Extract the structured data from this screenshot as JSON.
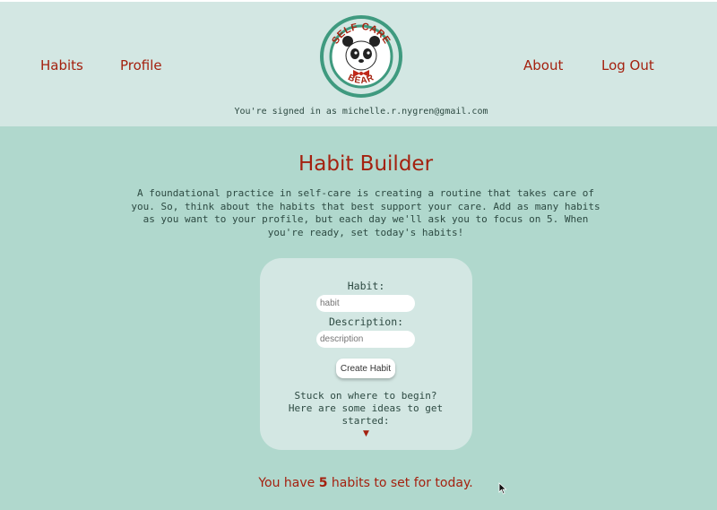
{
  "nav": {
    "habits": "Habits",
    "profile": "Profile",
    "about": "About",
    "logout": "Log Out"
  },
  "logo": {
    "top_text": "SELF CARE",
    "bottom_text": "BEAR"
  },
  "signed_in": "You're signed in as michelle.r.nygren@gmail.com",
  "main": {
    "title": "Habit Builder",
    "intro": "A foundational practice in self-care is creating a routine that takes care of you. So, think about the habits that best support your care. Add as many habits as you want to your profile, but each day we'll ask you to focus on 5. When you're ready, set today's habits!"
  },
  "form": {
    "habit_label": "Habit:",
    "habit_placeholder": "habit",
    "description_label": "Description:",
    "description_placeholder": "description",
    "create_button": "Create Habit",
    "stuck_text": "Stuck on where to begin? Here are some ideas to get started:",
    "ideas_toggle": "▼"
  },
  "status": {
    "prefix": "You have ",
    "count": "5",
    "suffix": " habits to set for today."
  },
  "colors": {
    "accent": "#a4210f",
    "header_bg": "#d3e7e3",
    "page_bg": "#b0d8cd",
    "logo_ring": "#3f9a7f"
  }
}
